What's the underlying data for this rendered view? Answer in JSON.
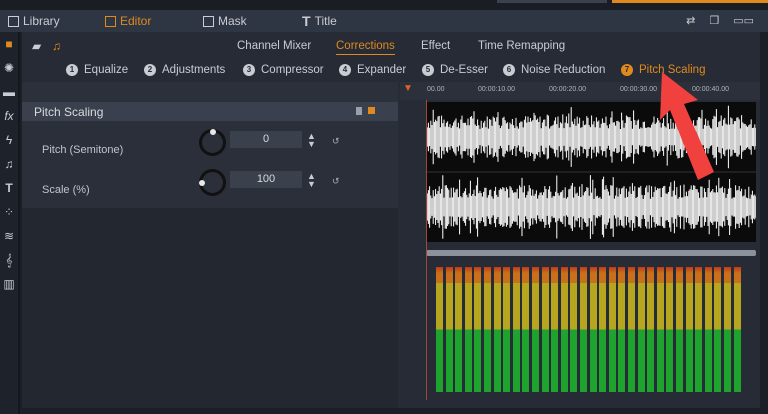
{
  "top_tabs": [
    {
      "label": "Library",
      "icon": "library-icon"
    },
    {
      "label": "Editor",
      "icon": "editor-icon",
      "active": true
    },
    {
      "label": "Mask",
      "icon": "mask-icon"
    },
    {
      "label": "Title",
      "icon": "title-icon"
    }
  ],
  "categories": [
    {
      "label": "Channel Mixer"
    },
    {
      "label": "Corrections",
      "active": true
    },
    {
      "label": "Effect"
    },
    {
      "label": "Time Remapping"
    }
  ],
  "sub_tabs": [
    {
      "n": "1",
      "label": "Equalize"
    },
    {
      "n": "2",
      "label": "Adjustments"
    },
    {
      "n": "3",
      "label": "Compressor"
    },
    {
      "n": "4",
      "label": "Expander"
    },
    {
      "n": "5",
      "label": "De-Esser"
    },
    {
      "n": "6",
      "label": "Noise Reduction"
    },
    {
      "n": "7",
      "label": "Pitch Scaling",
      "active": true
    }
  ],
  "panel": {
    "title": "Pitch Scaling",
    "params": [
      {
        "label": "Pitch (Semitone)",
        "value": "0"
      },
      {
        "label": "Scale (%)",
        "value": "100"
      }
    ]
  },
  "ruler": [
    "00.00",
    "00:00:10.00",
    "00:00:20.00",
    "00:00:30.00",
    "00:00:40.00"
  ],
  "colors": {
    "accent": "#e08a1e",
    "annotation_arrow": "#f0413f"
  }
}
